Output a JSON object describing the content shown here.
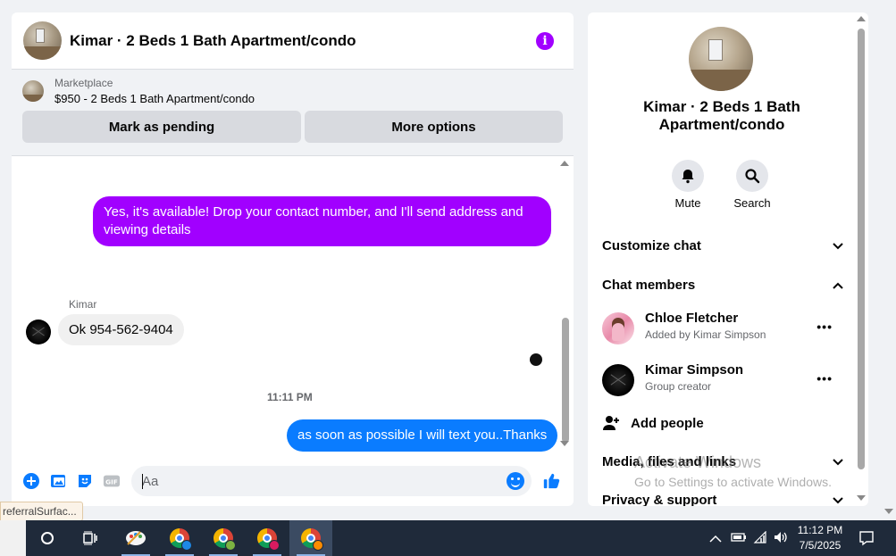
{
  "chat": {
    "title": "Kimar · 2 Beds 1 Bath Apartment/condo",
    "info_icon": "info-icon",
    "marketplace": {
      "label": "Marketplace",
      "listing": "$950 - 2 Beds 1 Bath Apartment/condo",
      "buttons": [
        "Mark as pending",
        "More options"
      ]
    },
    "messages": {
      "outgoing_1": "Yes, it's available! Drop your contact number, and I'll send address and viewing details",
      "sender_name": "Kimar",
      "incoming_1": "Ok 954-562-9404",
      "timestamp": "11:11 PM",
      "outgoing_2": "as soon as possible I will text you..Thanks"
    },
    "composer": {
      "placeholder": "Aa",
      "icons": [
        "plus-icon",
        "image-icon",
        "sticker-icon",
        "gif-icon",
        "emoji-icon",
        "like-icon"
      ],
      "gif_label": "GIF"
    }
  },
  "tooltip": "referralSurfac...",
  "side": {
    "title": "Kimar · 2 Beds 1 Bath Apartment/condo",
    "actions": [
      {
        "icon": "bell-icon",
        "label": "Mute"
      },
      {
        "icon": "search-icon",
        "label": "Search"
      }
    ],
    "sections": {
      "customize": "Customize chat",
      "members": "Chat members",
      "media": "Media, files and links",
      "privacy": "Privacy & support"
    },
    "members": [
      {
        "name": "Chloe Fletcher",
        "sub": "Added by Kimar Simpson"
      },
      {
        "name": "Kimar Simpson",
        "sub": "Group creator"
      }
    ],
    "more_label": "•••",
    "add_people": "Add people"
  },
  "watermark": {
    "line1": "Activate Windows",
    "line2": "Go to Settings to activate Windows."
  },
  "taskbar": {
    "time": "11:12 PM",
    "date": "7/5/2025"
  },
  "colors": {
    "accent_purple": "#a100ff",
    "accent_blue": "#0a7cff",
    "taskbar": "#1f2a3a"
  }
}
